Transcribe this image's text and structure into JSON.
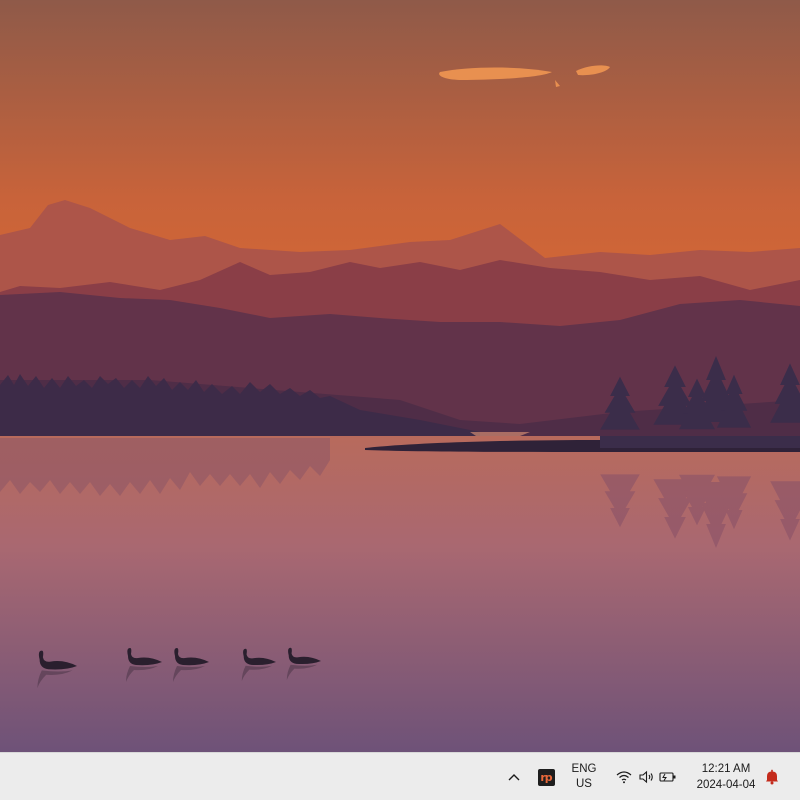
{
  "desktop": {
    "wallpaper": "sunset-lake-with-mountains-and-geese",
    "colors": {
      "sky_top": "#8f5a49",
      "sky_bottom": "#e36c2e",
      "water_top": "#b86a5c",
      "water_bottom": "#6e5278",
      "cloud": "#e89050"
    }
  },
  "taskbar": {
    "background": "#ececec",
    "overflow_icon": "chevron-up-icon",
    "pinned_app_icon": "rp-app-icon",
    "language": {
      "line1": "ENG",
      "line2": "US"
    },
    "system_icons": [
      "wifi-icon",
      "volume-icon",
      "battery-icon"
    ],
    "clock": {
      "time": "12:21 AM",
      "date": "2024-04-04"
    },
    "notification_icon": "bell-icon",
    "notification_color": "#c42b1c"
  }
}
